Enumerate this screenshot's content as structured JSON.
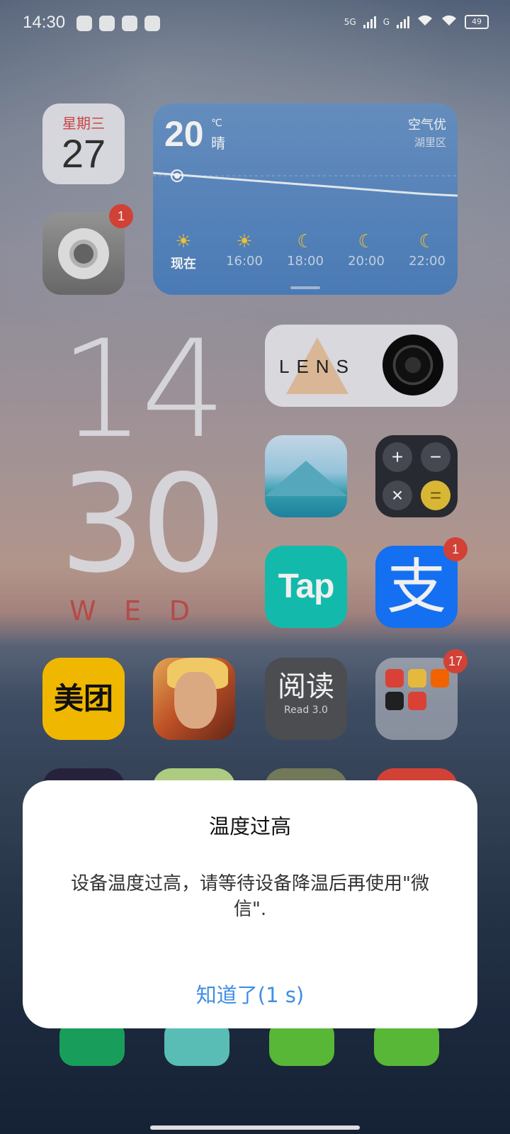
{
  "status_bar": {
    "time": "14:30",
    "network_1": "5G",
    "network_2": "G",
    "battery": "49"
  },
  "calendar_widget": {
    "weekday": "星期三",
    "day": "27"
  },
  "settings_app": {
    "badge": "1"
  },
  "weather_widget": {
    "temperature": "20",
    "unit": "℃",
    "condition": "晴",
    "air_quality": "空气优",
    "district": "湖里区",
    "forecast": [
      {
        "label": "现在",
        "icon": "sun-icon"
      },
      {
        "label": "16:00",
        "icon": "sun-icon"
      },
      {
        "label": "18:00",
        "icon": "moon-icon"
      },
      {
        "label": "20:00",
        "icon": "moon-icon"
      },
      {
        "label": "22:00",
        "icon": "moon-icon"
      }
    ]
  },
  "clock_widget": {
    "hours": "14",
    "minutes": "30",
    "weekday_letters": [
      "W",
      "E",
      "D"
    ]
  },
  "lens_widget": {
    "label": "LENS"
  },
  "apps": {
    "tap_label": "Tap",
    "alipay_label": "支",
    "alipay_badge": "1",
    "meituan_label": "美团",
    "reader_title": "阅读",
    "reader_sub": "Read 3.0",
    "folder_badge": "17"
  },
  "dialog": {
    "title": "温度过高",
    "message": "设备温度过高，请等待设备降温后再使用\"微信\".",
    "button": "知道了(1 s)"
  },
  "colors": {
    "accent": "#3f8ee6",
    "badge": "#e0463a",
    "weather_bg": "#5b8cc6"
  }
}
